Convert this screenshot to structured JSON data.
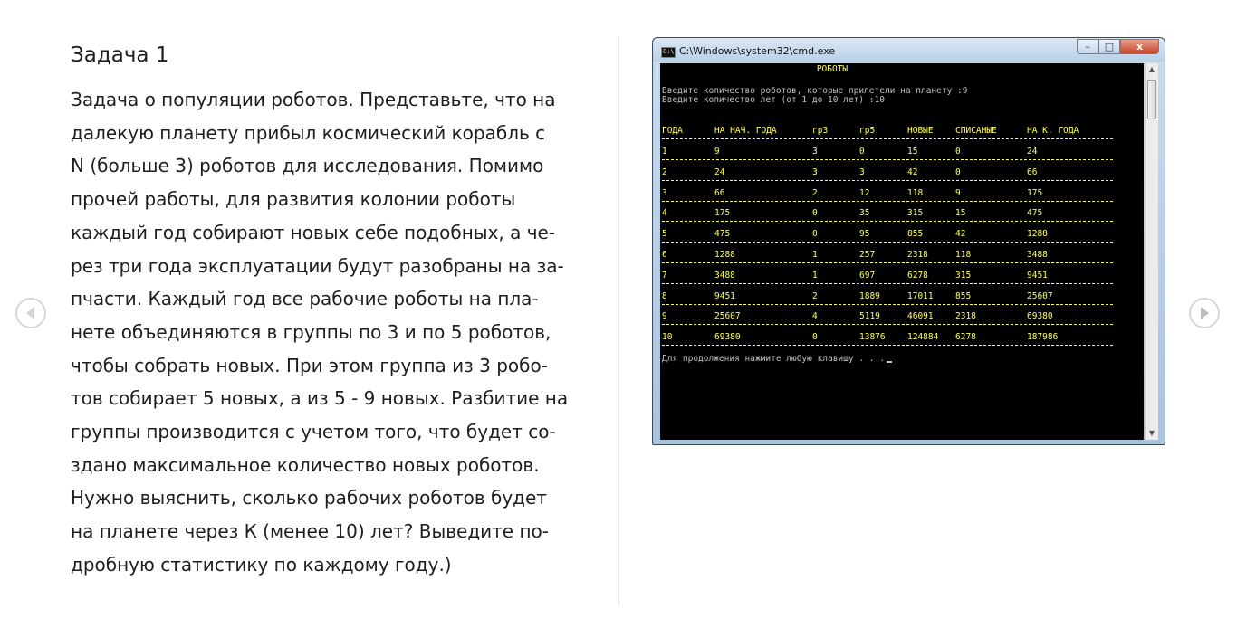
{
  "task": {
    "title": "Задача 1",
    "lines": [
      "Задача о популяции роботов. Представьте, что на",
      "далекую планету прибыл космический корабль с",
      "N (больше 3) роботов для исследования. Помимо",
      "прочей работы, для развития колонии роботы",
      "каждый год собирают новых себе подобных, а че-",
      "рез три года эксплуатации будут разобраны на за-",
      "пчасти. Каждый год все рабочие роботы на пла-",
      "нете объединяются в группы по 3 и по 5 роботов,",
      "чтобы собрать новых. При этом группа из 3 робо-",
      "тов собирает 5 новых, а из 5 - 9 новых. Разбитие на",
      "группы производится с учетом того, что будет со-",
      "здано максимальное количество новых роботов.",
      "Нужно выяснить, сколько рабочих роботов будет",
      "на планете через К (менее 10) лет? Выведите по-",
      "дробную статистику по каждому году.)"
    ]
  },
  "window": {
    "title": "C:\\Windows\\system32\\cmd.exe",
    "icon_text": "C:\\",
    "minimize": "–",
    "maximize": "□",
    "close": "x"
  },
  "console": {
    "banner": "РОБОТЫ",
    "prompt_robots": "Введите количество роботов, которые прилетели на планету :9",
    "prompt_years": "Введите количество лет (от 1 до 10 лет) :10",
    "headers": [
      "ГОДА",
      "НА НАЧ. ГОДА",
      "гр3",
      "гр5",
      "НОВЫЕ",
      "СПИСАНЫЕ",
      "НА К. ГОДА"
    ],
    "rows": [
      [
        "1",
        "9",
        "3",
        "0",
        "15",
        "0",
        "24"
      ],
      [
        "2",
        "24",
        "3",
        "3",
        "42",
        "0",
        "66"
      ],
      [
        "3",
        "66",
        "2",
        "12",
        "118",
        "9",
        "175"
      ],
      [
        "4",
        "175",
        "0",
        "35",
        "315",
        "15",
        "475"
      ],
      [
        "5",
        "475",
        "0",
        "95",
        "855",
        "42",
        "1288"
      ],
      [
        "6",
        "1288",
        "1",
        "257",
        "2318",
        "118",
        "3488"
      ],
      [
        "7",
        "3488",
        "1",
        "697",
        "6278",
        "315",
        "9451"
      ],
      [
        "8",
        "9451",
        "2",
        "1889",
        "17011",
        "855",
        "25607"
      ],
      [
        "9",
        "25607",
        "4",
        "5119",
        "46091",
        "2318",
        "69380"
      ],
      [
        "10",
        "69380",
        "0",
        "13876",
        "124884",
        "6278",
        "187986"
      ]
    ],
    "footer": "Для продолжения нажмите любую клавишу . . ."
  },
  "colors": {
    "console_bg": "#000000",
    "console_text": "#c0c0c0",
    "console_accent": "#ffff55",
    "nav_circle": "#d6d6d6"
  },
  "icons": {
    "prev": "triangle-left-icon",
    "next": "triangle-right-icon"
  }
}
